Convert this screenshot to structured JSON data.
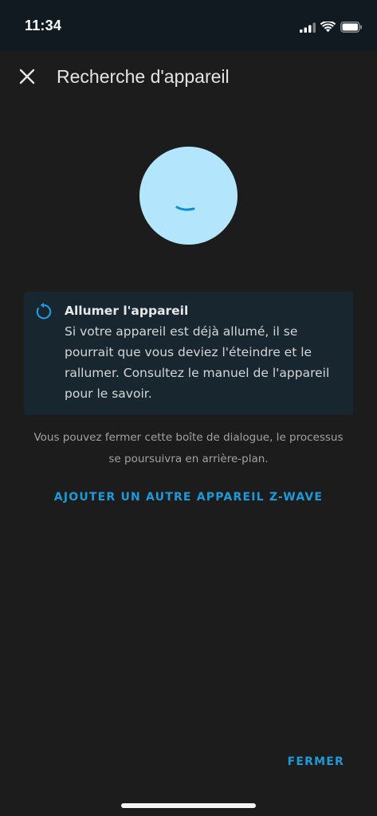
{
  "status_bar": {
    "time": "11:34"
  },
  "header": {
    "title": "Recherche d'appareil"
  },
  "info_box": {
    "title": "Allumer l'appareil",
    "text": "Si votre appareil est déjà allumé, il se pourrait que vous deviez l'éteindre et le rallumer. Consultez le manuel de l'appareil pour le savoir."
  },
  "hint": "Vous pouvez fermer cette boîte de dialogue, le processus se poursuivra en arrière-plan.",
  "actions": {
    "add_other": "AJOUTER UN AUTRE APPAREIL Z-WAVE",
    "close": "FERMER"
  },
  "colors": {
    "accent": "#1f9ad9",
    "circle": "#b3e5fc",
    "info_bg": "#17262f",
    "background": "#1c1c1c"
  }
}
